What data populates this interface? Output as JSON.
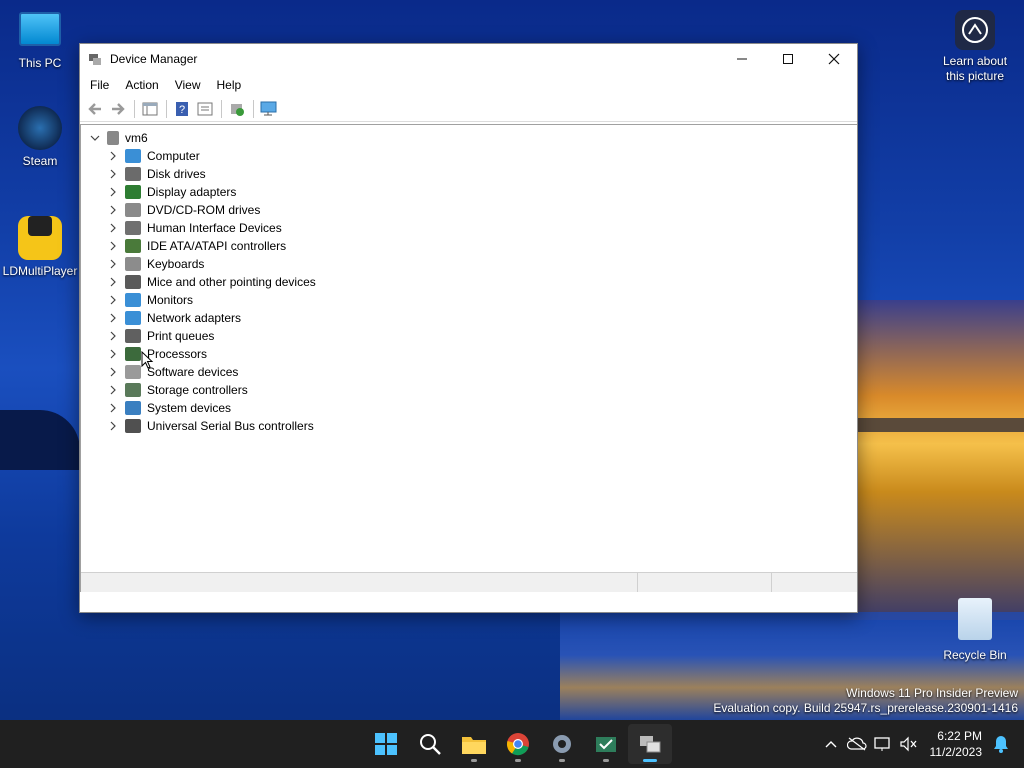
{
  "desktop": {
    "icons": [
      {
        "label": "This PC"
      },
      {
        "label": "Steam"
      },
      {
        "label": "LDMultiPlayer"
      },
      {
        "label": "Recycle Bin"
      }
    ],
    "learn_about": "Learn about this picture",
    "watermark_line1": "Windows 11 Pro Insider Preview",
    "watermark_line2": "Evaluation copy. Build 25947.rs_prerelease.230901-1416"
  },
  "window": {
    "title": "Device Manager",
    "menu": [
      "File",
      "Action",
      "View",
      "Help"
    ],
    "root_node": "vm6",
    "devices": [
      {
        "label": "Computer",
        "icon": "computer-icon",
        "color": "#3a8fd6"
      },
      {
        "label": "Disk drives",
        "icon": "disk-drive-icon",
        "color": "#6b6b6b"
      },
      {
        "label": "Display adapters",
        "icon": "display-adapter-icon",
        "color": "#2e7d32"
      },
      {
        "label": "DVD/CD-ROM drives",
        "icon": "dvd-drive-icon",
        "color": "#8a8a8a"
      },
      {
        "label": "Human Interface Devices",
        "icon": "hid-icon",
        "color": "#707070"
      },
      {
        "label": "IDE ATA/ATAPI controllers",
        "icon": "ide-controller-icon",
        "color": "#4a7a3a"
      },
      {
        "label": "Keyboards",
        "icon": "keyboard-icon",
        "color": "#8c8c8c"
      },
      {
        "label": "Mice and other pointing devices",
        "icon": "mouse-icon",
        "color": "#5a5a5a"
      },
      {
        "label": "Monitors",
        "icon": "monitor-icon",
        "color": "#3a8fd6"
      },
      {
        "label": "Network adapters",
        "icon": "network-adapter-icon",
        "color": "#3a8fd6"
      },
      {
        "label": "Print queues",
        "icon": "printer-icon",
        "color": "#606060"
      },
      {
        "label": "Processors",
        "icon": "processor-icon",
        "color": "#3c6a3c"
      },
      {
        "label": "Software devices",
        "icon": "software-device-icon",
        "color": "#9a9a9a"
      },
      {
        "label": "Storage controllers",
        "icon": "storage-controller-icon",
        "color": "#5a7a5a"
      },
      {
        "label": "System devices",
        "icon": "system-device-icon",
        "color": "#3a7fc0"
      },
      {
        "label": "Universal Serial Bus controllers",
        "icon": "usb-icon",
        "color": "#505050"
      }
    ]
  },
  "taskbar": {
    "apps": [
      "start-icon",
      "search-icon",
      "file-explorer-icon",
      "chrome-icon",
      "settings-icon",
      "feedback-hub-icon",
      "device-manager-icon"
    ],
    "time": "6:22 PM",
    "date": "11/2/2023"
  }
}
